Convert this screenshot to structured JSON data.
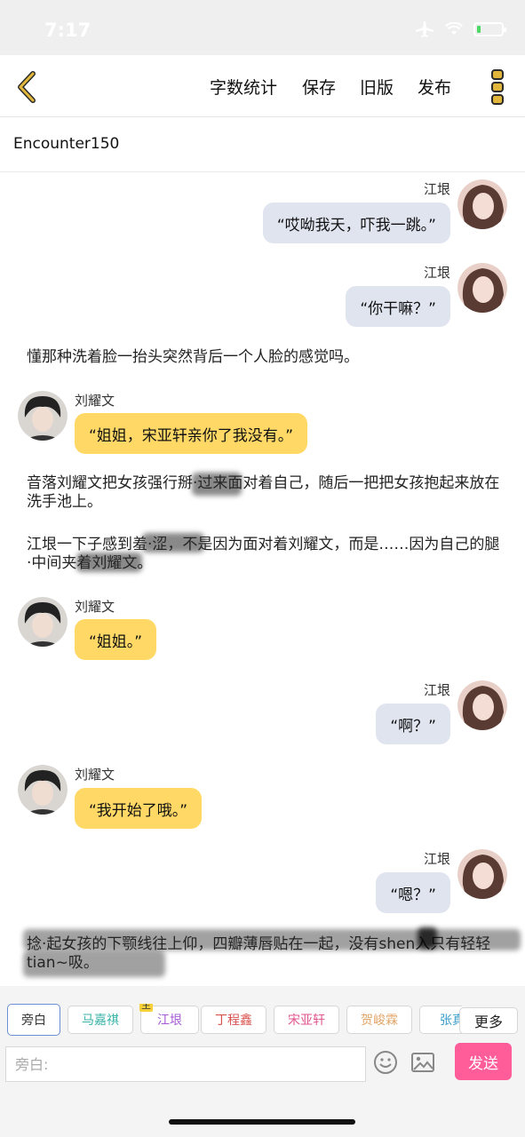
{
  "status": {
    "time": "7:17",
    "battery_level": 0.15,
    "battery_color": "#4cd964"
  },
  "toolbar": {
    "back_icon": "chevron-left-icon",
    "word_count": "字数统计",
    "save": "保存",
    "old_version": "旧版",
    "publish": "发布",
    "more_icon": "three-dots-vertical-icon",
    "accent": "#e0b73a"
  },
  "story": {
    "title": "Encounter150"
  },
  "messages": [
    {
      "kind": "right",
      "name": "江垠",
      "text": "“哎呦我天，吓我一跳。”"
    },
    {
      "kind": "right",
      "name": "江垠",
      "text": "“你干嘛？”"
    },
    {
      "kind": "narration",
      "text": "懂那种洗着脸一抬头突然背后一个人脸的感觉吗。"
    },
    {
      "kind": "left",
      "name": "刘耀文",
      "text": "“姐姐，宋亚轩亲你了我没有。”"
    },
    {
      "kind": "narration",
      "text": "音落刘耀文把女孩强行掰·过来面对着自己，随后一把把女孩抱起来放在洗手池上。"
    },
    {
      "kind": "narration",
      "text": "江垠一下子感到羞·涩，不是因为面对着刘耀文，而是……因为自己的腿·中间夹着刘耀文。"
    },
    {
      "kind": "left",
      "name": "刘耀文",
      "text": "“姐姐。”"
    },
    {
      "kind": "right",
      "name": "江垠",
      "text": "“啊？”"
    },
    {
      "kind": "left",
      "name": "刘耀文",
      "text": "“我开始了哦。”"
    },
    {
      "kind": "right",
      "name": "江垠",
      "text": "“嗯？”"
    },
    {
      "kind": "narration",
      "text": "捻·起女孩的下颚线往上仰，四瓣薄唇贴在一起，没有shen入只有轻轻tian~吸。"
    }
  ],
  "characters": [
    {
      "label": "旁白",
      "color": "#333333"
    },
    {
      "label": "马嘉祺",
      "color": "#3bb3a8"
    },
    {
      "label": "江垠",
      "color": "#a45ad6",
      "badge": "主"
    },
    {
      "label": "丁程鑫",
      "color": "#d9534f"
    },
    {
      "label": "宋亚轩",
      "color": "#e0568f"
    },
    {
      "label": "贺峻霖",
      "color": "#e2a66a"
    },
    {
      "label": "张真",
      "color": "#3a9dc9"
    }
  ],
  "more_characters": "更多",
  "composer": {
    "placeholder": "旁白:",
    "emoji_icon": "smiley-face-icon",
    "image_icon": "image-icon",
    "send": "发送",
    "send_color": "#ff5c9a"
  }
}
